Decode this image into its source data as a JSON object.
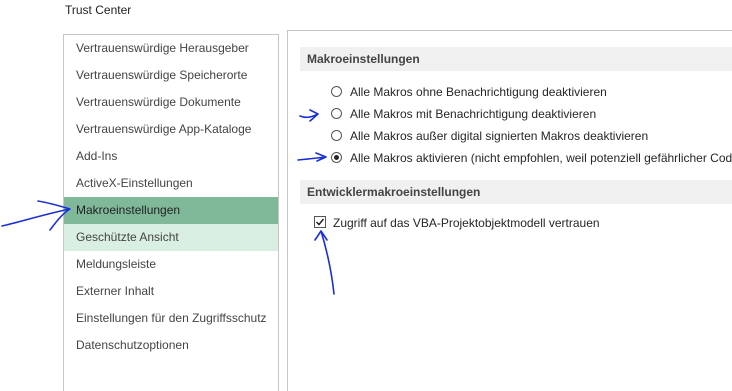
{
  "window": {
    "title": "Trust Center"
  },
  "sidebar": {
    "items": [
      {
        "label": "Vertrauenswürdige Herausgeber"
      },
      {
        "label": "Vertrauenswürdige Speicherorte"
      },
      {
        "label": "Vertrauenswürdige Dokumente"
      },
      {
        "label": "Vertrauenswürdige App-Kataloge"
      },
      {
        "label": "Add-Ins"
      },
      {
        "label": "ActiveX-Einstellungen"
      },
      {
        "label": "Makroeinstellungen",
        "selected": true
      },
      {
        "label": "Geschützte Ansicht",
        "hover": true
      },
      {
        "label": "Meldungsleiste"
      },
      {
        "label": "Externer Inhalt"
      },
      {
        "label": "Einstellungen für den Zugriffsschutz"
      },
      {
        "label": "Datenschutzoptionen"
      }
    ]
  },
  "macro_settings": {
    "header": "Makroeinstellungen",
    "options": [
      {
        "label": "Alle Makros ohne Benachrichtigung deaktivieren",
        "checked": false
      },
      {
        "label": "Alle Makros mit Benachrichtigung deaktivieren",
        "checked": false
      },
      {
        "label": "Alle Makros außer digital signierten Makros deaktivieren",
        "checked": false
      },
      {
        "label": "Alle Makros aktivieren (nicht empfohlen, weil potenziell gefährlicher Code",
        "checked": true
      }
    ]
  },
  "developer_settings": {
    "header": "Entwicklermakroeinstellungen",
    "vba_access_label": "Zugriff auf das VBA-Projektobjektmodell vertrauen",
    "vba_access_checked": true
  },
  "colors": {
    "selected_item": "#7fb99a",
    "hover_item": "#d8efe1",
    "annotation_ink": "#1a2fd6"
  }
}
